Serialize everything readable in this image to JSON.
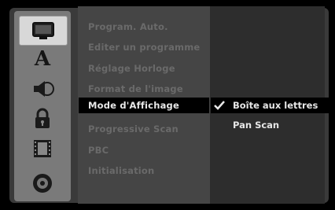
{
  "menu": {
    "items": [
      {
        "label": "Program. Auto."
      },
      {
        "label": "Editer un programme"
      },
      {
        "label": "Réglage Horloge"
      },
      {
        "label": "Format de l'image"
      },
      {
        "label": "Mode d'Affichage"
      },
      {
        "label": "Progressive Scan"
      },
      {
        "label": "PBC"
      },
      {
        "label": "Initialisation"
      }
    ],
    "selected_index": 4
  },
  "options": {
    "items": [
      {
        "label": "Boîte aux lettres",
        "checked": true
      },
      {
        "label": "Pan Scan",
        "checked": false
      }
    ]
  },
  "icons": [
    {
      "name": "monitor-icon"
    },
    {
      "name": "language-icon",
      "glyph": "A"
    },
    {
      "name": "audio-speaker-icon"
    },
    {
      "name": "lock-icon"
    },
    {
      "name": "film-icon"
    },
    {
      "name": "disc-icon"
    }
  ],
  "colors": {
    "highlight_bg": "#000000",
    "highlight_text": "#e8e8e8",
    "dim_text": "#6a6a6a"
  }
}
